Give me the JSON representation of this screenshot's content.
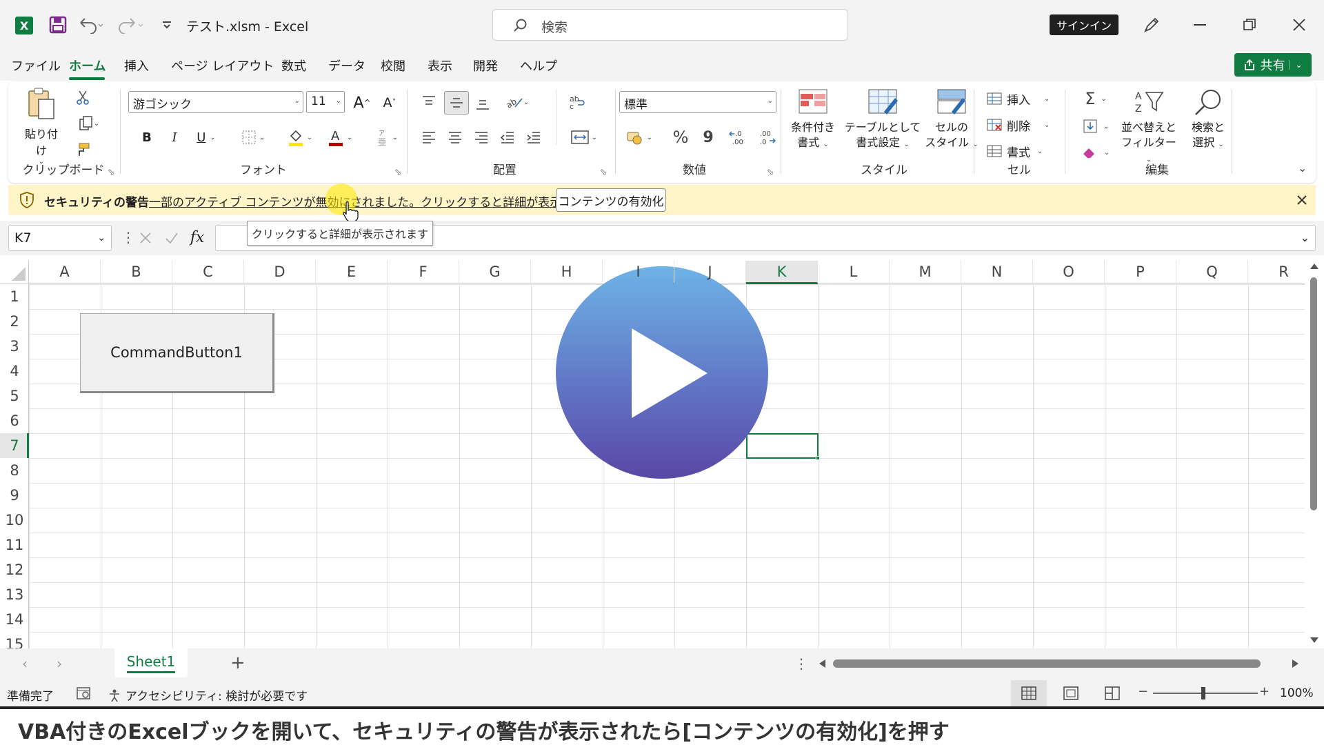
{
  "title": {
    "filename": "テスト.xlsm",
    "sep": " - ",
    "app": "Excel",
    "search_placeholder": "検索",
    "signin": "サインイン"
  },
  "menu": {
    "tabs": [
      "ファイル",
      "ホーム",
      "挿入",
      "ページ レイアウト",
      "数式",
      "データ",
      "校閲",
      "表示",
      "開発",
      "ヘルプ"
    ],
    "active": "ホーム",
    "share": "共有"
  },
  "ribbon": {
    "clipboard": {
      "paste": "貼り付け",
      "label": "クリップボード"
    },
    "font": {
      "name": "游ゴシック",
      "size": "11",
      "label": "フォント",
      "bold": "B",
      "italic": "I",
      "underline": "U"
    },
    "align": {
      "label": "配置"
    },
    "number": {
      "format": "標準",
      "label": "数値",
      "percent": "%",
      "comma": "9"
    },
    "styles": {
      "cond": [
        "条件付き",
        "書式"
      ],
      "table": [
        "テーブルとして",
        "書式設定"
      ],
      "cell": [
        "セルの",
        "スタイル"
      ],
      "label": "スタイル"
    },
    "cells": {
      "insert": "挿入",
      "delete": "削除",
      "format": "書式",
      "label": "セル"
    },
    "edit": {
      "sort": [
        "並べ替えと",
        "フィルター"
      ],
      "find": [
        "検索と",
        "選択"
      ],
      "label": "編集"
    }
  },
  "security": {
    "title": "セキュリティの警告",
    "message": "一部のアクティブ コンテンツが無効にされました。クリックすると詳細が表示されます。",
    "button": "コンテンツの有効化",
    "tooltip": "クリックすると詳細が表示されます"
  },
  "formula": {
    "namebox": "K7",
    "fx": "fx",
    "value": ""
  },
  "grid": {
    "columns": [
      "A",
      "B",
      "C",
      "D",
      "E",
      "F",
      "G",
      "H",
      "I",
      "J",
      "K",
      "L",
      "M",
      "N",
      "O",
      "P",
      "Q",
      "R"
    ],
    "rows": [
      "1",
      "2",
      "3",
      "4",
      "5",
      "6",
      "7",
      "8",
      "9",
      "10",
      "11",
      "12",
      "13",
      "14",
      "15"
    ],
    "selected_cell": "K7",
    "command_button": "CommandButton1"
  },
  "sheets": {
    "tabs": [
      "Sheet1"
    ],
    "active": "Sheet1"
  },
  "status": {
    "ready": "準備完了",
    "accessibility": "アクセシビリティ: 検討が必要です",
    "zoom": "100%"
  },
  "caption": "VBA付きのExcelブックを開いて、セキュリティの警告が表示されたら[コンテンツの有効化]を押す",
  "colors": {
    "excel_green": "#107c41",
    "accent_purple": "#5b4ea8",
    "play_top": "#6eb3e6",
    "play_bottom": "#5a47a6"
  }
}
